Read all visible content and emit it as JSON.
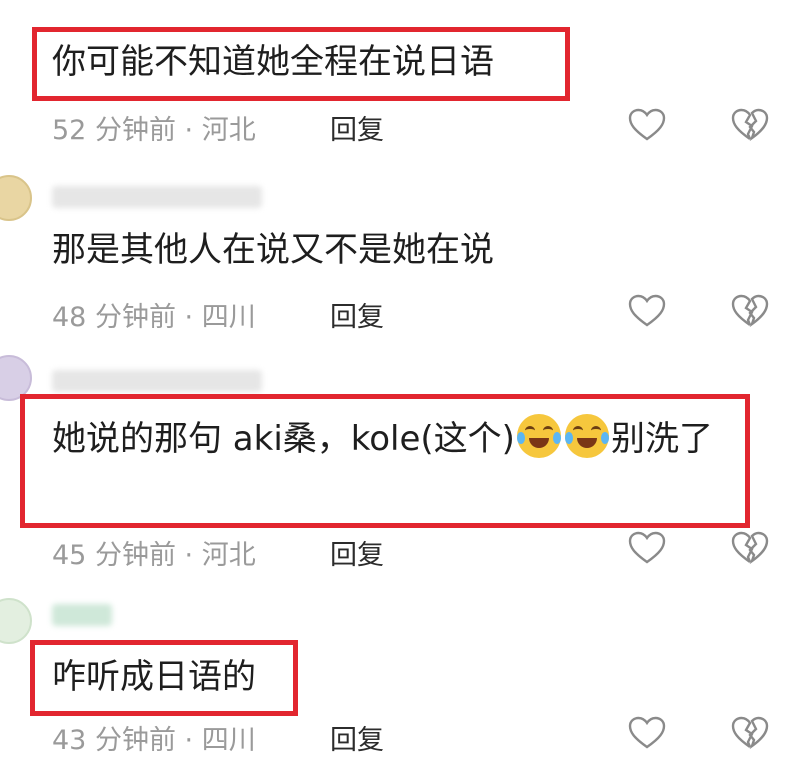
{
  "comments": [
    {
      "text": "你可能不知道她全程在说日语",
      "time": "52 分钟前",
      "location": "河北",
      "reply": "回复"
    },
    {
      "text": "那是其他人在说又不是她在说",
      "time": "48 分钟前",
      "location": "四川",
      "reply": "回复"
    },
    {
      "text_before": "她说的那句  aki桑，kole(这个)",
      "text_after": "别洗了",
      "emoji": "laughing-crying-emoji",
      "time": "45 分钟前",
      "location": "河北",
      "reply": "回复"
    },
    {
      "text": "咋听成日语的",
      "time": "43 分钟前",
      "location": "四川",
      "reply": "回复"
    }
  ],
  "separator": " · ",
  "colors": {
    "highlight": "#e2262f",
    "meta": "#9a9a9a"
  }
}
